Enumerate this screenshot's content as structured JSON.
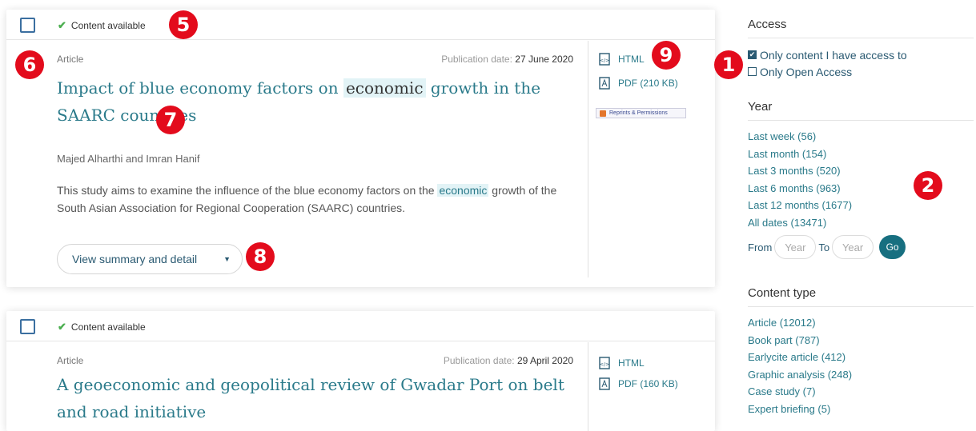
{
  "results": [
    {
      "availability": "Content available",
      "type": "Article",
      "pub_date_label": "Publication date:",
      "pub_date": "27 June 2020",
      "title_before": "Impact of blue economy factors on ",
      "title_highlight": "economic",
      "title_after": " growth in the SAARC countries",
      "authors": "Majed Alharthi and Imran Hanif",
      "abstract_before": "This study aims to examine the influence of the blue economy factors on the ",
      "abstract_highlight": "economic",
      "abstract_after": " growth of the South Asian Association for Regional Cooperation (SAARC) countries.",
      "view_button": "View summary and detail",
      "html_label": "HTML",
      "pdf_label": "PDF (210 KB)",
      "reprints_label": "Reprints & Permissions"
    },
    {
      "availability": "Content available",
      "type": "Article",
      "pub_date_label": "Publication date:",
      "pub_date": "29 April 2020",
      "title_before": "A geoeconomic and geopolitical review of Gwadar Port on belt and road initiative",
      "html_label": "HTML",
      "pdf_label": "PDF (160 KB)"
    }
  ],
  "filters": {
    "access": {
      "heading": "Access",
      "options": [
        {
          "label": "Only content I have access to",
          "checked": true
        },
        {
          "label": "Only Open Access",
          "checked": false
        }
      ]
    },
    "year": {
      "heading": "Year",
      "links": [
        "Last week (56)",
        "Last month (154)",
        "Last 3 months (520)",
        "Last 6 months (963)",
        "Last 12 months (1677)",
        "All dates (13471)"
      ],
      "from_label": "From",
      "to_label": "To",
      "year_placeholder": "Year",
      "go_label": "Go"
    },
    "content_type": {
      "heading": "Content type",
      "links": [
        "Article (12012)",
        "Book part (787)",
        "Earlycite article (412)",
        "Graphic analysis (248)",
        "Case study (7)",
        "Expert briefing (5)"
      ]
    }
  },
  "markers": [
    "1",
    "2",
    "5",
    "6",
    "7",
    "8",
    "9"
  ],
  "colors": {
    "marker": "#e30b1c",
    "link": "#2a7a8a",
    "go_button": "#176f80"
  }
}
